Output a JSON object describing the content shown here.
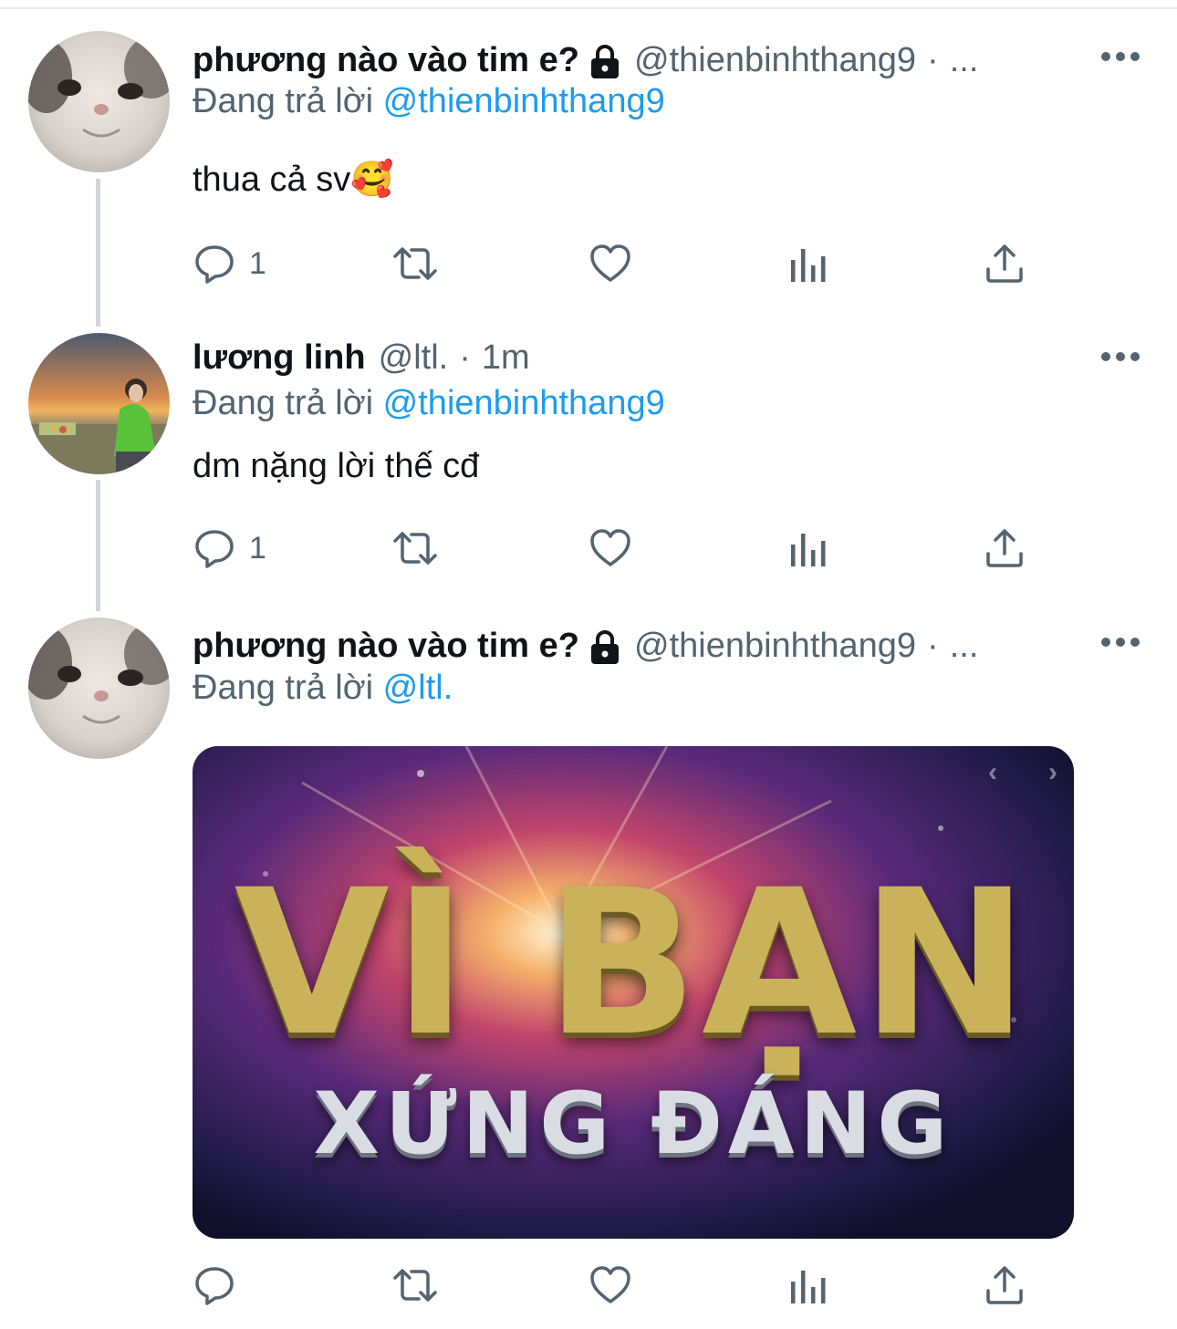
{
  "tweets": [
    {
      "display_name": "phương nào vào tim e?",
      "handle": "@thienbinhthang9",
      "separator": "·",
      "time": "...",
      "reply_prefix": "Đang trả lời",
      "reply_to": "@thienbinhthang9",
      "text": "thua cả sv🥰",
      "reply_count": "1",
      "avatar": "cat-face-avatar"
    },
    {
      "display_name": "lương linh",
      "handle": "@ltl.",
      "separator": "·",
      "time": "1m",
      "reply_prefix": "Đang trả lời",
      "reply_to": "@thienbinhthang9",
      "text": "dm nặng lời thế cđ",
      "reply_count": "1",
      "avatar": "beach-sunset-avatar"
    },
    {
      "display_name": "phương nào vào tim e?",
      "handle": "@thienbinhthang9",
      "separator": "·",
      "time": "...",
      "reply_prefix": "Đang trả lời",
      "reply_to": "@ltl.",
      "media": {
        "title": "VÌ BẠN",
        "subtitle": "XỨNG ĐÁNG",
        "nav_prev": "‹",
        "nav_next": "›"
      },
      "reply_count": "",
      "avatar": "cat-face-avatar"
    }
  ],
  "icons": {
    "more": "more-horizontal-icon",
    "reply": "reply-icon",
    "retweet": "retweet-icon",
    "like": "heart-icon",
    "views": "analytics-icon",
    "share": "share-icon",
    "lock": "lock-icon"
  },
  "colors": {
    "text_primary": "#0f1419",
    "text_secondary": "#536471",
    "mention": "#1d9bf0",
    "thread_line": "#d0d6db"
  }
}
